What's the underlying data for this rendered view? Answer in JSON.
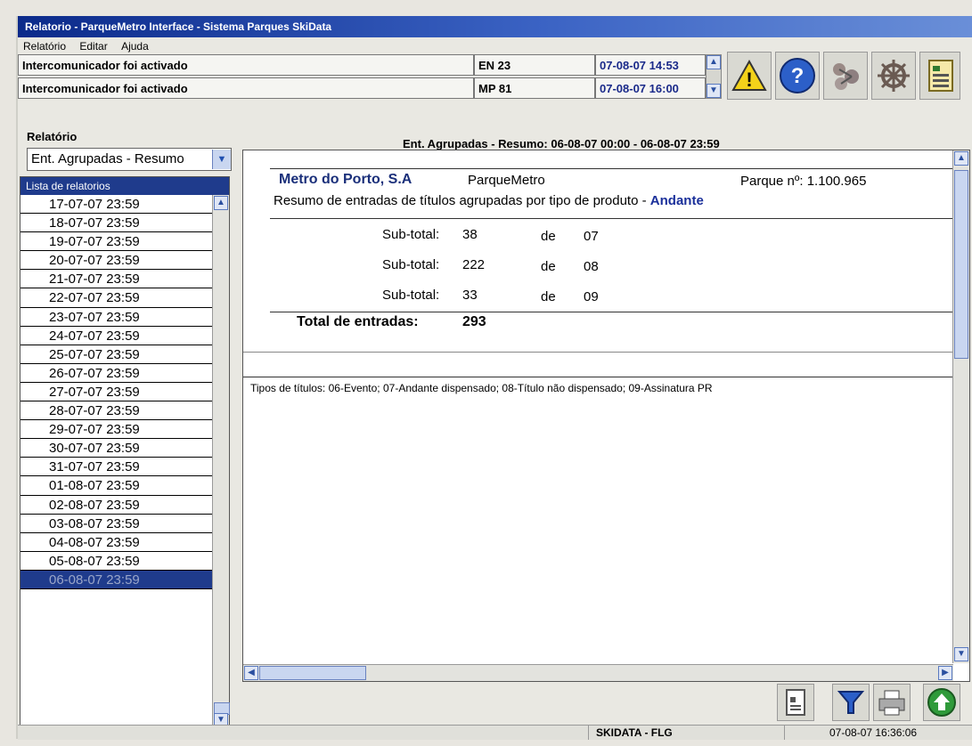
{
  "window": {
    "title": "Relatorio - ParqueMetro Interface - Sistema Parques SkiData"
  },
  "menu": [
    "Relatório",
    "Editar",
    "Ajuda"
  ],
  "alarms": [
    {
      "message": "Intercomunicador foi activado",
      "device": "EN 23",
      "datetime": "07-08-07 14:53"
    },
    {
      "message": "Intercomunicador foi activado",
      "device": "MP 81",
      "datetime": "07-08-07 16:00"
    }
  ],
  "toolbar_icons": [
    "warning-icon",
    "help-icon",
    "network-icon",
    "settings-wheel-icon",
    "reports-icon"
  ],
  "sidebar": {
    "report_label": "Relatório",
    "report_combo_value": "Ent. Agrupadas - Resumo",
    "list_header": "Lista de relatorios",
    "items": [
      "17-07-07 23:59",
      "18-07-07 23:59",
      "19-07-07 23:59",
      "20-07-07 23:59",
      "21-07-07 23:59",
      "22-07-07 23:59",
      "23-07-07 23:59",
      "24-07-07 23:59",
      "25-07-07 23:59",
      "26-07-07 23:59",
      "27-07-07 23:59",
      "28-07-07 23:59",
      "29-07-07 23:59",
      "30-07-07 23:59",
      "31-07-07 23:59",
      "01-08-07 23:59",
      "02-08-07 23:59",
      "03-08-07 23:59",
      "04-08-07 23:59",
      "05-08-07 23:59",
      "06-08-07 23:59"
    ],
    "selected_index": 20
  },
  "report": {
    "heading": "Ent. Agrupadas - Resumo: 06-08-07 00:00 - 06-08-07 23:59",
    "company": "Metro do Porto, S.A",
    "system": "ParqueMetro",
    "park_label": "Parque nº: 1.100.965",
    "subtitle": "Resumo de entradas de títulos agrupadas por tipo de produto -",
    "product": "Andante",
    "subtotals": [
      {
        "label": "Sub-total:",
        "value": "38",
        "de": "de",
        "code": "07"
      },
      {
        "label": "Sub-total:",
        "value": "222",
        "de": "de",
        "code": "08"
      },
      {
        "label": "Sub-total:",
        "value": "33",
        "de": "de",
        "code": "09"
      }
    ],
    "total_label": "Total de entradas:",
    "total_value": "293",
    "legend": "Tipos de títulos: 06-Evento; 07-Andante dispensado; 08-Título não dispensado; 09-Assinatura PR"
  },
  "footer_icons": [
    "document-icon",
    "filter-icon",
    "printer-icon",
    "upload-icon"
  ],
  "status": {
    "center": "SKIDATA - FLG",
    "right": "07-08-07 16:36:06"
  }
}
